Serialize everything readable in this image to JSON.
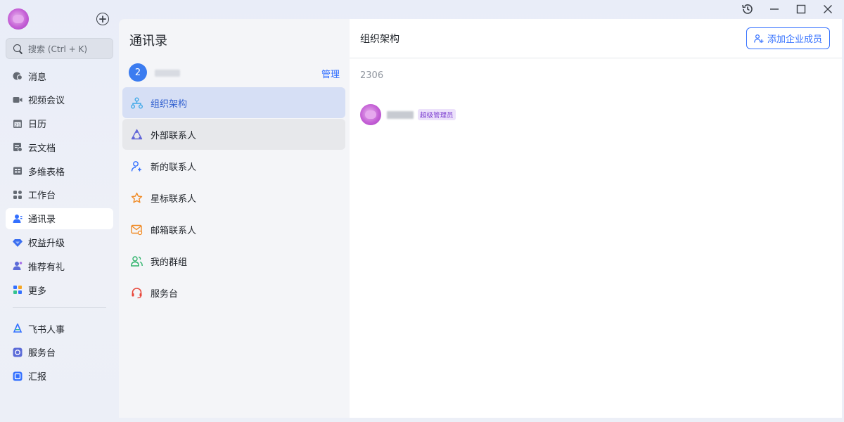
{
  "nav": {
    "search_placeholder": "搜索 (Ctrl + K)",
    "items": [
      {
        "label": "消息",
        "icon": "message-icon"
      },
      {
        "label": "视频会议",
        "icon": "video-icon"
      },
      {
        "label": "日历",
        "icon": "calendar-icon"
      },
      {
        "label": "云文档",
        "icon": "cloud-doc-icon"
      },
      {
        "label": "多维表格",
        "icon": "table-icon"
      },
      {
        "label": "工作台",
        "icon": "workbench-icon"
      },
      {
        "label": "通讯录",
        "icon": "contacts-icon",
        "active": true
      },
      {
        "label": "权益升级",
        "icon": "diamond-icon"
      },
      {
        "label": "推荐有礼",
        "icon": "refer-icon"
      },
      {
        "label": "更多",
        "icon": "more-icon"
      }
    ],
    "apps": [
      {
        "label": "飞书人事",
        "icon": "hr-icon"
      },
      {
        "label": "服务台",
        "icon": "service-desk-icon"
      },
      {
        "label": "汇报",
        "icon": "report-icon"
      }
    ],
    "calendar_day": "21"
  },
  "middle": {
    "title": "通讯录",
    "org_badge": "2",
    "manage_label": "管理",
    "items": [
      {
        "label": "组织架构",
        "icon": "org-chart-icon",
        "active": true
      },
      {
        "label": "外部联系人",
        "icon": "external-contacts-icon"
      },
      {
        "label": "新的联系人",
        "icon": "new-contact-icon"
      },
      {
        "label": "星标联系人",
        "icon": "star-icon"
      },
      {
        "label": "邮箱联系人",
        "icon": "mail-contact-icon"
      },
      {
        "label": "我的群组",
        "icon": "group-icon"
      },
      {
        "label": "服务台",
        "icon": "headset-icon"
      }
    ]
  },
  "right": {
    "title": "组织架构",
    "add_member_label": "添加企业成员",
    "member_count": "2306",
    "member_role": "超级管理员"
  },
  "colors": {
    "accent": "#3370ff",
    "active_bg": "#d6dff5",
    "role_badge": "#7d3fd0"
  }
}
